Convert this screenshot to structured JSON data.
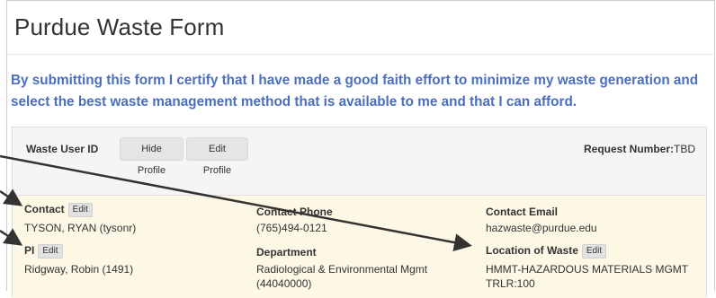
{
  "page": {
    "title": "Purdue Waste Form",
    "certify_text": "By submitting this form I certify that I have made a good faith effort to minimize my waste generation and select the best waste management method that is available to me and that I can afford."
  },
  "header": {
    "user_id_label": "Waste User ID",
    "hide_profile_label": "Hide Profile",
    "edit_profile_label": "Edit Profile",
    "request_number_label": "Request Number:",
    "request_number_value": "TBD"
  },
  "profile": {
    "contact_label": "Contact",
    "contact_value": "TYSON, RYAN (tysonr)",
    "contact_phone_label": "Contact Phone",
    "contact_phone_value": "(765)494-0121",
    "contact_email_label": "Contact Email",
    "contact_email_value": "hazwaste@purdue.edu",
    "pi_label": "PI",
    "pi_value": "Ridgway, Robin (1491)",
    "department_label": "Department",
    "department_value": "Radiological & Environmental Mgmt (44040000)",
    "location_label": "Location of Waste",
    "location_value": "HMMT-HAZARDOUS MATERIALS MGMT TRLR:100",
    "edit_label": "Edit"
  },
  "colors": {
    "certify_text": "#4a6ec0",
    "panel_header_bg": "#f5f5f5",
    "panel_body_bg": "#fcf8e5",
    "annotation_arrow": "#333333"
  },
  "annotations": {
    "arrow_icon": "annotation-arrow"
  }
}
